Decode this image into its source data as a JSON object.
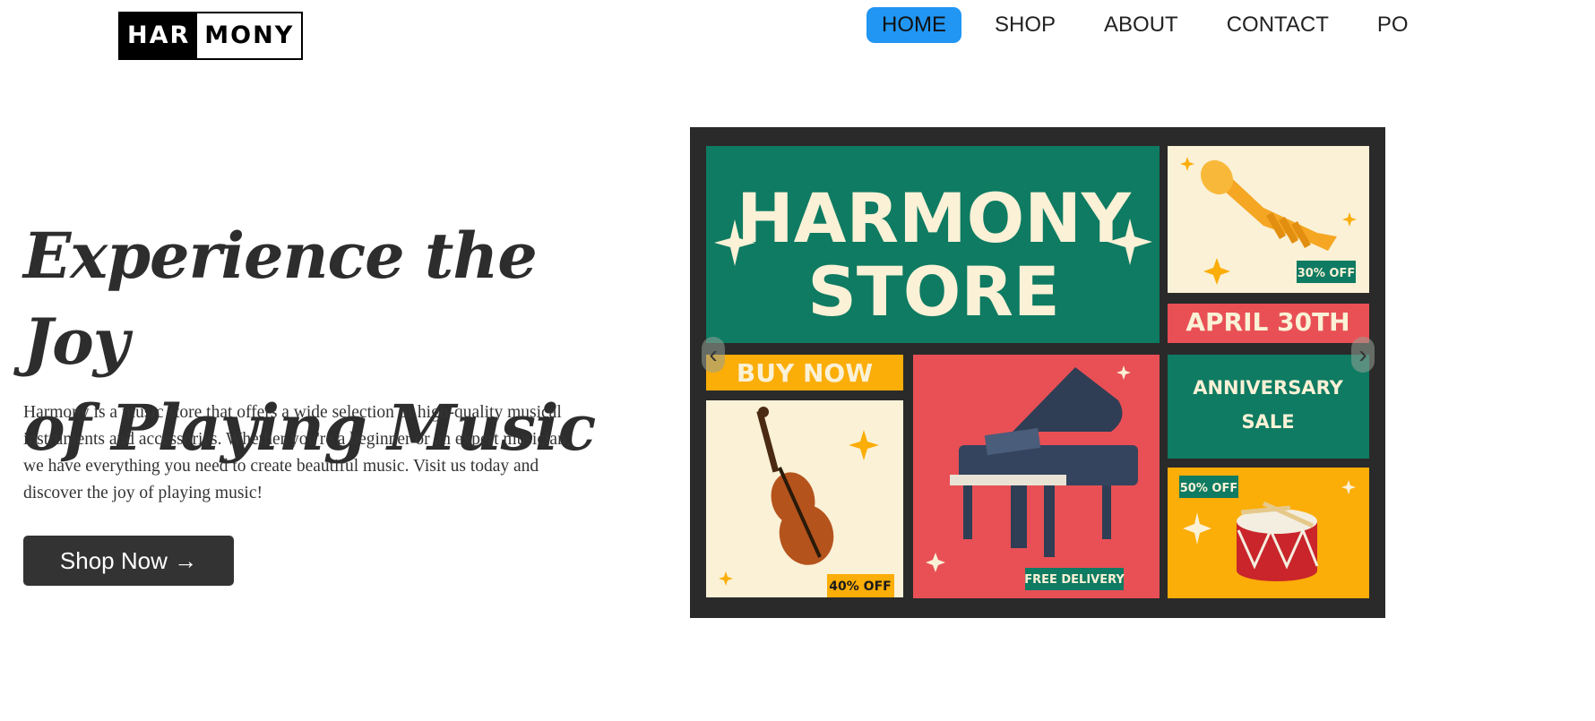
{
  "logo": {
    "part1": "HAR",
    "part2": "MONY"
  },
  "nav": {
    "items": [
      {
        "label": "HOME",
        "active": true
      },
      {
        "label": "SHOP"
      },
      {
        "label": "ABOUT"
      },
      {
        "label": "CONTACT"
      },
      {
        "label": "PO"
      }
    ]
  },
  "hero": {
    "title_line1": "Experience the Joy",
    "title_line2": "of Playing Music",
    "description": "Harmony is a music store that offers a wide selection of high-quality musical instruments and accessories. Whether you're a beginner or an expert musician, we have everything you need to create beautiful music. Visit us today and discover the joy of playing music!",
    "cta_label": "Shop Now →"
  },
  "banner": {
    "title_line1": "HARMONY",
    "title_line2": "STORE",
    "buy_now": "BUY NOW",
    "date": "APRIL 30TH",
    "anniversary_line1": "ANNIVERSARY",
    "anniversary_line2": "SALE",
    "trumpet_discount": "30% OFF",
    "violin_discount": "40% OFF",
    "drum_discount": "50% OFF",
    "delivery": "FREE DELIVERY",
    "colors": {
      "green": "#0e7b62",
      "cream": "#faf1d6",
      "red": "#e85055",
      "yellow": "#fbad08",
      "frame": "#2a2a2a"
    }
  },
  "carousel": {
    "prev_icon": "chevron-left-icon",
    "next_icon": "chevron-right-icon"
  }
}
